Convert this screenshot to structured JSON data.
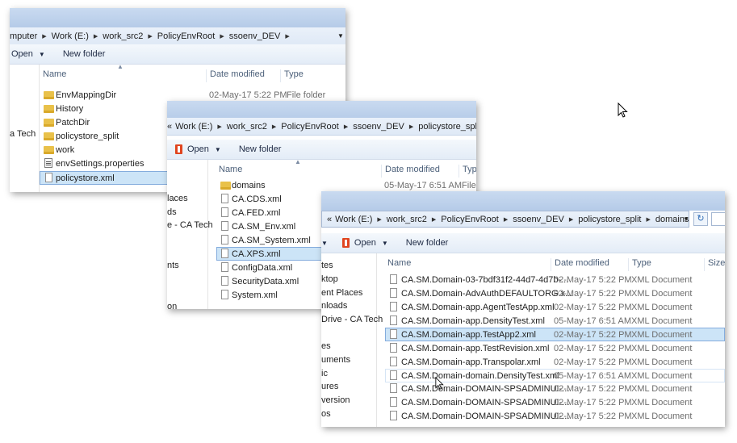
{
  "win1": {
    "crumbs": [
      "mputer",
      "Work (E:)",
      "work_src2",
      "PolicyEnvRoot",
      "ssoenv_DEV"
    ],
    "toolbar": {
      "open": "Open",
      "new_folder": "New folder"
    },
    "columns": {
      "name": "Name",
      "date": "Date modified",
      "type": "Type"
    },
    "nav_items": [
      {
        "label": "a Tech"
      }
    ],
    "rows": [
      {
        "name": "EnvMappingDir",
        "date": "02-May-17 5:22 PM",
        "type": "File folder",
        "icon": "folder-icon"
      },
      {
        "name": "History",
        "date": "",
        "type": "",
        "icon": "folder-icon"
      },
      {
        "name": "PatchDir",
        "date": "",
        "type": "",
        "icon": "folder-icon"
      },
      {
        "name": "policystore_split",
        "date": "",
        "type": "",
        "icon": "folder-icon"
      },
      {
        "name": "work",
        "date": "",
        "type": "",
        "icon": "folder-icon"
      },
      {
        "name": "envSettings.properties",
        "date": "",
        "type": "",
        "icon": "properties-file-icon"
      },
      {
        "name": "policystore.xml",
        "date": "",
        "type": "",
        "icon": "document-icon",
        "selected": true
      }
    ]
  },
  "win2": {
    "crumbs": [
      "Work (E:)",
      "work_src2",
      "PolicyEnvRoot",
      "ssoenv_DEV",
      "policystore_split"
    ],
    "toolbar": {
      "open": "Open",
      "new_folder": "New folder"
    },
    "columns": {
      "name": "Name",
      "date": "Date modified",
      "type": "Type"
    },
    "nav_items": [
      {
        "label": "laces"
      },
      {
        "label": "ds"
      },
      {
        "label": "e - CA Tech"
      },
      {
        "label": "nts"
      },
      {
        "label": "on"
      }
    ],
    "rows": [
      {
        "name": "domains",
        "date": "05-May-17 6:51 AM",
        "type": "File f",
        "icon": "folder-icon"
      },
      {
        "name": "CA.CDS.xml",
        "icon": "document-icon"
      },
      {
        "name": "CA.FED.xml",
        "icon": "document-icon"
      },
      {
        "name": "CA.SM_Env.xml",
        "icon": "document-icon"
      },
      {
        "name": "CA.SM_System.xml",
        "icon": "document-icon"
      },
      {
        "name": "CA.XPS.xml",
        "icon": "document-icon",
        "selected": true
      },
      {
        "name": "ConfigData.xml",
        "icon": "document-icon"
      },
      {
        "name": "SecurityData.xml",
        "icon": "document-icon"
      },
      {
        "name": "System.xml",
        "icon": "document-icon"
      }
    ]
  },
  "win3": {
    "crumbs": [
      "Work (E:)",
      "work_src2",
      "PolicyEnvRoot",
      "ssoenv_DEV",
      "policystore_split",
      "domains"
    ],
    "toolbar": {
      "open": "Open",
      "new_folder": "New folder"
    },
    "columns": {
      "name": "Name",
      "date": "Date modified",
      "type": "Type",
      "size": "Size"
    },
    "nav_items": [
      {
        "label": "tes"
      },
      {
        "label": "ktop"
      },
      {
        "label": "ent Places"
      },
      {
        "label": "nloads"
      },
      {
        "label": "Drive - CA Tech"
      },
      {
        "label": "es"
      },
      {
        "label": "uments"
      },
      {
        "label": "ic"
      },
      {
        "label": "ures"
      },
      {
        "label": "version"
      },
      {
        "label": "os"
      }
    ],
    "rows": [
      {
        "name": "CA.SM.Domain-03-7bdf31f2-44d7-4d7b-...",
        "date": "02-May-17 5:22 PM",
        "type": "XML Document"
      },
      {
        "name": "CA.SM.Domain-AdvAuthDEFAULTORG.x...",
        "date": "02-May-17 5:22 PM",
        "type": "XML Document"
      },
      {
        "name": "CA.SM.Domain-app.AgentTestApp.xml",
        "date": "02-May-17 5:22 PM",
        "type": "XML Document"
      },
      {
        "name": "CA.SM.Domain-app.DensityTest.xml",
        "date": "05-May-17 6:51 AM",
        "type": "XML Document"
      },
      {
        "name": "CA.SM.Domain-app.TestApp2.xml",
        "date": "02-May-17 5:22 PM",
        "type": "XML Document",
        "selected": true
      },
      {
        "name": "CA.SM.Domain-app.TestRevision.xml",
        "date": "02-May-17 5:22 PM",
        "type": "XML Document"
      },
      {
        "name": "CA.SM.Domain-app.Transpolar.xml",
        "date": "02-May-17 5:22 PM",
        "type": "XML Document"
      },
      {
        "name": "CA.SM.Domain-domain.DensityTest.xml",
        "date": "05-May-17 6:51 AM",
        "type": "XML Document",
        "hover": true
      },
      {
        "name": "CA.SM.Domain-DOMAIN-SPSADMINUI-...",
        "date": "02-May-17 5:22 PM",
        "type": "XML Document"
      },
      {
        "name": "CA.SM.Domain-DOMAIN-SPSADMINUI-...",
        "date": "02-May-17 5:22 PM",
        "type": "XML Document"
      },
      {
        "name": "CA.SM.Domain-DOMAIN-SPSADMINUI-...",
        "date": "02-May-17 5:22 PM",
        "type": "XML Document"
      }
    ]
  }
}
